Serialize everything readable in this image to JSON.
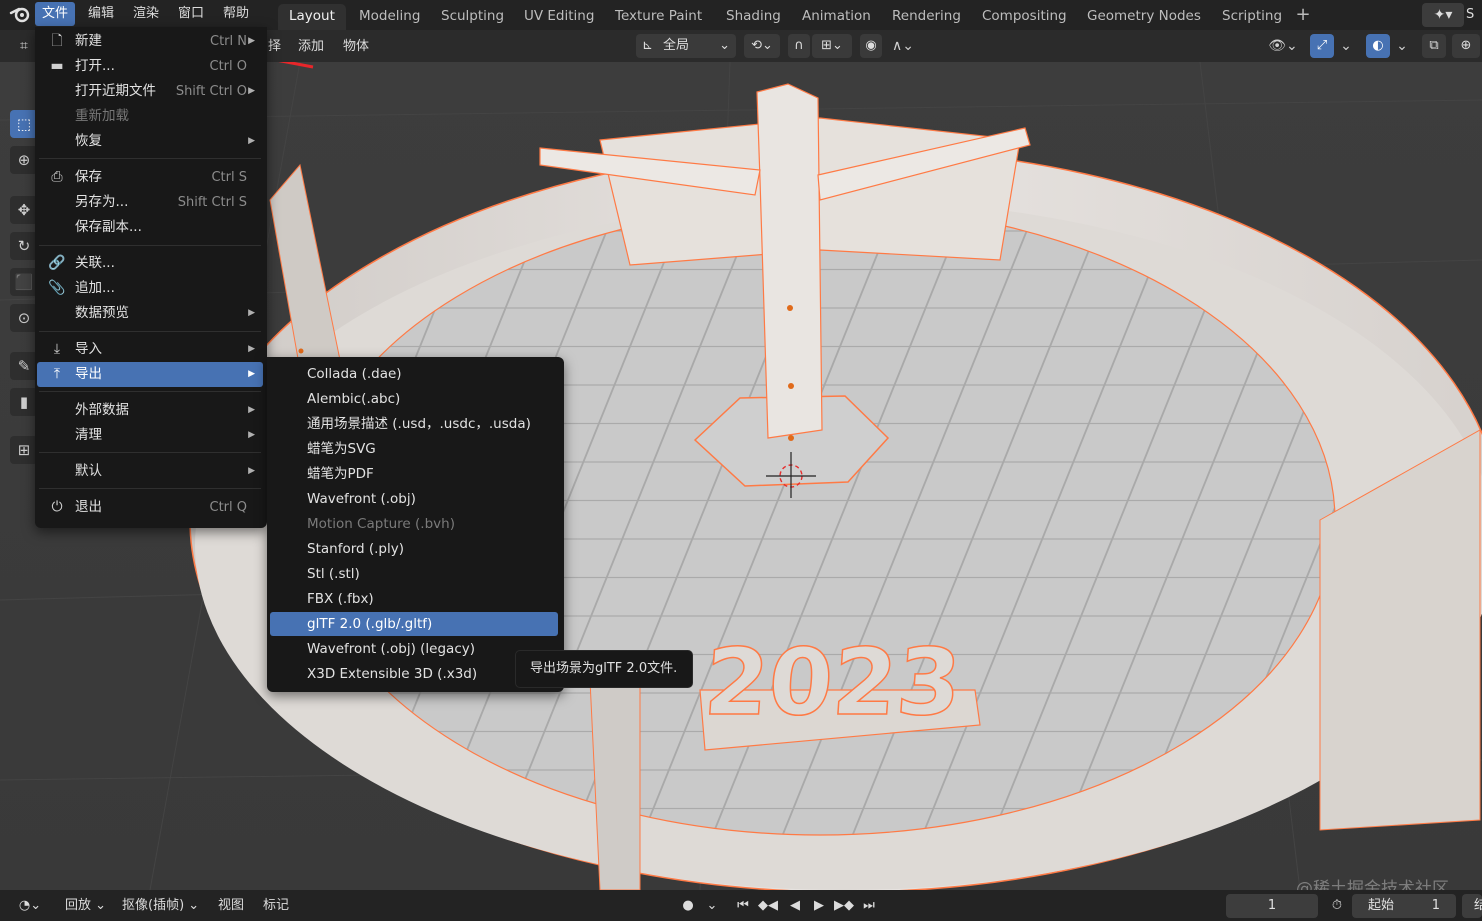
{
  "topbar": {
    "logo_icon": "blender-logo-icon",
    "menus": [
      "文件",
      "编辑",
      "渲染",
      "窗口",
      "帮助"
    ],
    "workspaces": [
      "Layout",
      "Modeling",
      "Sculpting",
      "UV Editing",
      "Texture Paint",
      "Shading",
      "Animation",
      "Rendering",
      "Compositing",
      "Geometry Nodes",
      "Scripting"
    ],
    "active_workspace": "Layout",
    "add_workspace": "+",
    "scene_label": "S"
  },
  "header": {
    "select_partial": "择",
    "add_label": "添加",
    "object_label": "物体",
    "orientation_label": "全局"
  },
  "file_menu": {
    "items": [
      {
        "label": "新建",
        "shortcut": "Ctrl N",
        "submenu": true,
        "icon": "new-file-icon"
      },
      {
        "label": "打开...",
        "shortcut": "Ctrl O",
        "submenu": false,
        "icon": "folder-icon"
      },
      {
        "label": "打开近期文件",
        "shortcut": "Shift Ctrl O",
        "submenu": true,
        "icon": ""
      },
      {
        "label": "重新加载",
        "shortcut": "",
        "submenu": false,
        "icon": "",
        "disabled": true
      },
      {
        "label": "恢复",
        "shortcut": "",
        "submenu": true,
        "icon": ""
      },
      {
        "label": "保存",
        "shortcut": "Ctrl S",
        "submenu": false,
        "icon": "save-icon"
      },
      {
        "label": "另存为...",
        "shortcut": "Shift Ctrl S",
        "submenu": false,
        "icon": ""
      },
      {
        "label": "保存副本...",
        "shortcut": "",
        "submenu": false,
        "icon": ""
      },
      {
        "label": "关联...",
        "shortcut": "",
        "submenu": false,
        "icon": "link-icon"
      },
      {
        "label": "追加...",
        "shortcut": "",
        "submenu": false,
        "icon": "append-icon"
      },
      {
        "label": "数据预览",
        "shortcut": "",
        "submenu": true,
        "icon": ""
      },
      {
        "label": "导入",
        "shortcut": "",
        "submenu": true,
        "icon": "import-icon"
      },
      {
        "label": "导出",
        "shortcut": "",
        "submenu": true,
        "icon": "export-icon",
        "selected": true
      },
      {
        "label": "外部数据",
        "shortcut": "",
        "submenu": true,
        "icon": ""
      },
      {
        "label": "清理",
        "shortcut": "",
        "submenu": true,
        "icon": ""
      },
      {
        "label": "默认",
        "shortcut": "",
        "submenu": true,
        "icon": ""
      },
      {
        "label": "退出",
        "shortcut": "Ctrl Q",
        "submenu": false,
        "icon": "power-icon"
      }
    ]
  },
  "export_menu": {
    "items": [
      {
        "label": "Collada (.dae)"
      },
      {
        "label": "Alembic(.abc)"
      },
      {
        "label": "通用场景描述 (.usd，.usdc，.usda)"
      },
      {
        "label": "蜡笔为SVG"
      },
      {
        "label": "蜡笔为PDF"
      },
      {
        "label": "Wavefront (.obj)"
      },
      {
        "label": "Motion Capture (.bvh)",
        "disabled": true
      },
      {
        "label": "Stanford (.ply)"
      },
      {
        "label": "Stl (.stl)"
      },
      {
        "label": "FBX (.fbx)"
      },
      {
        "label": "glTF 2.0 (.glb/.gltf)",
        "selected": true
      },
      {
        "label": "Wavefront (.obj) (legacy)"
      },
      {
        "label": "X3D Extensible 3D (.x3d)"
      }
    ]
  },
  "tooltip": {
    "text": "导出场景为glTF 2.0文件."
  },
  "viewport": {
    "model_text": "2023",
    "watermark": "@稀土掘金技术社区"
  },
  "bottombar": {
    "playback_label": "回放",
    "keying_label": "抠像(插帧)",
    "view_label": "视图",
    "marker_label": "标记",
    "current_frame": "1",
    "start_label": "起始",
    "start_frame": "1",
    "end_partial": "结"
  },
  "colors": {
    "accent": "#4772b3",
    "menu_bg": "#181818",
    "selection_outline": "#ff7a45",
    "annotation_arrow": "#e8262a"
  }
}
